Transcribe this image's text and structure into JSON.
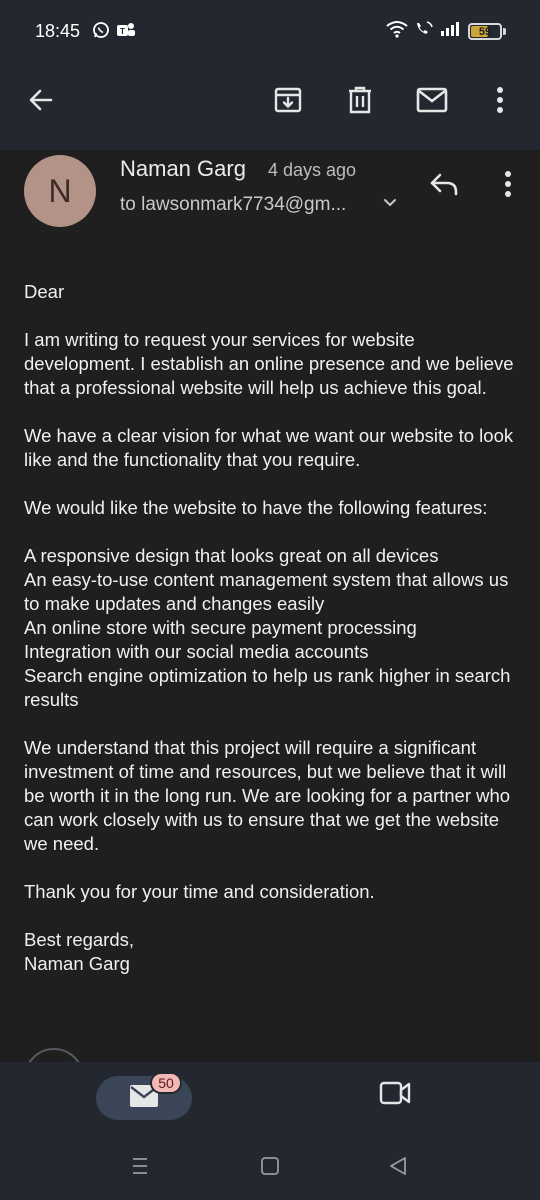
{
  "status_bar": {
    "time": "18:45",
    "battery": "59",
    "battery_level": 0.59
  },
  "app_bar": {
    "back": "back",
    "actions": [
      "archive",
      "delete",
      "mark-unread",
      "more"
    ]
  },
  "email": {
    "sender_initial": "N",
    "sender_name": "Naman Garg",
    "sent_time": "4 days ago",
    "recipient": "to lawsonmark7734@gm...",
    "body": {
      "greeting": "Dear",
      "p1": "I am writing to request your services for website development. I establish an online presence and we believe that a professional website will help us achieve this goal.",
      "p2": "We have a clear vision for what we want our website to look like and the functionality that you require.",
      "p3": "We would like the website to have the following features:",
      "features": [
        "A responsive design that looks great on all devices",
        "An easy-to-use content management system that allows us to make updates and changes easily",
        "An online store with secure payment processing",
        "Integration with our social media accounts",
        "Search engine optimization to help us rank higher in search results"
      ],
      "p4": "We understand that this project will require a significant investment of time and resources, but we believe that it will be worth it in the long run. We are looking for a partner who can work closely with us to ensure that we get the website we need.",
      "p5": "Thank you for your time and consideration.",
      "closing": "Best regards,",
      "signature": "Naman Garg"
    }
  },
  "bottom_nav": {
    "mail_badge": "50"
  },
  "colors": {
    "background": "#1f1f1f",
    "bar": "#232830",
    "avatar": "#b39288",
    "badge": "#f2b8b5"
  }
}
